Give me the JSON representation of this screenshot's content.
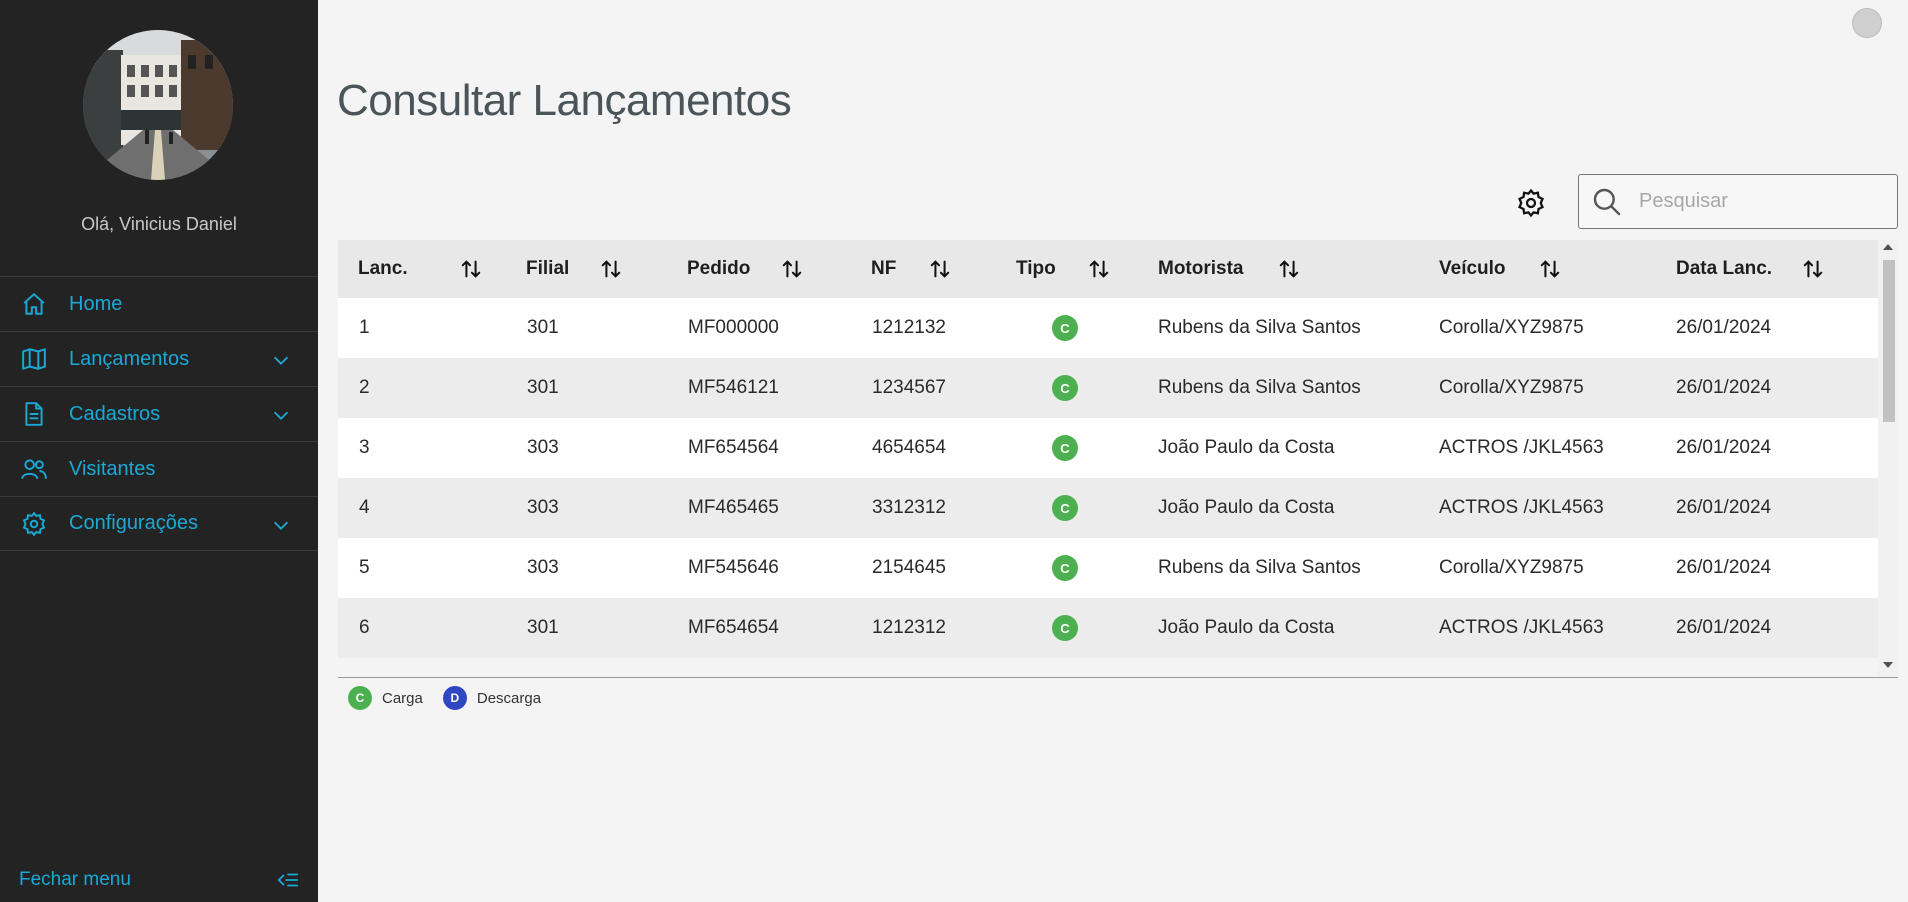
{
  "sidebar": {
    "greeting": "Olá, Vinicius Daniel",
    "items": [
      {
        "label": "Home",
        "icon": "home-icon",
        "expandable": false
      },
      {
        "label": "Lançamentos",
        "icon": "book-icon",
        "expandable": true
      },
      {
        "label": "Cadastros",
        "icon": "document-icon",
        "expandable": true
      },
      {
        "label": "Visitantes",
        "icon": "users-icon",
        "expandable": false
      },
      {
        "label": "Configurações",
        "icon": "gear-icon",
        "expandable": true
      }
    ],
    "close_label": "Fechar menu"
  },
  "main": {
    "title": "Consultar Lançamentos",
    "search": {
      "placeholder": "Pesquisar",
      "value": ""
    }
  },
  "table": {
    "columns": [
      "Lanc.",
      "Filial",
      "Pedido",
      "NF",
      "Tipo",
      "Motorista",
      "Veículo",
      "Data Lanc."
    ],
    "rows": [
      {
        "lanc": "1",
        "filial": "301",
        "pedido": "MF000000",
        "nf": "1212132",
        "tipo": "C",
        "motorista": "Rubens da Silva Santos",
        "veiculo": "Corolla/XYZ9875",
        "data": "26/01/2024"
      },
      {
        "lanc": "2",
        "filial": "301",
        "pedido": "MF546121",
        "nf": "1234567",
        "tipo": "C",
        "motorista": "Rubens da Silva Santos",
        "veiculo": "Corolla/XYZ9875",
        "data": "26/01/2024"
      },
      {
        "lanc": "3",
        "filial": "303",
        "pedido": "MF654564",
        "nf": "4654654",
        "tipo": "C",
        "motorista": "João Paulo da Costa",
        "veiculo": "ACTROS /JKL4563",
        "data": "26/01/2024"
      },
      {
        "lanc": "4",
        "filial": "303",
        "pedido": "MF465465",
        "nf": "3312312",
        "tipo": "C",
        "motorista": "João Paulo da Costa",
        "veiculo": "ACTROS /JKL4563",
        "data": "26/01/2024"
      },
      {
        "lanc": "5",
        "filial": "303",
        "pedido": "MF545646",
        "nf": "2154645",
        "tipo": "C",
        "motorista": "Rubens da Silva Santos",
        "veiculo": "Corolla/XYZ9875",
        "data": "26/01/2024"
      },
      {
        "lanc": "6",
        "filial": "301",
        "pedido": "MF654654",
        "nf": "1212312",
        "tipo": "C",
        "motorista": "João Paulo da Costa",
        "veiculo": "ACTROS /JKL4563",
        "data": "26/01/2024"
      }
    ]
  },
  "legend": [
    {
      "letter": "C",
      "label": "Carga",
      "color": "#4caf50"
    },
    {
      "letter": "D",
      "label": "Descarga",
      "color": "#3047c4"
    }
  ],
  "colors": {
    "accent": "#1aa9d6",
    "sidebar_bg": "#232323",
    "carga": "#4caf50",
    "descarga": "#3047c4"
  }
}
